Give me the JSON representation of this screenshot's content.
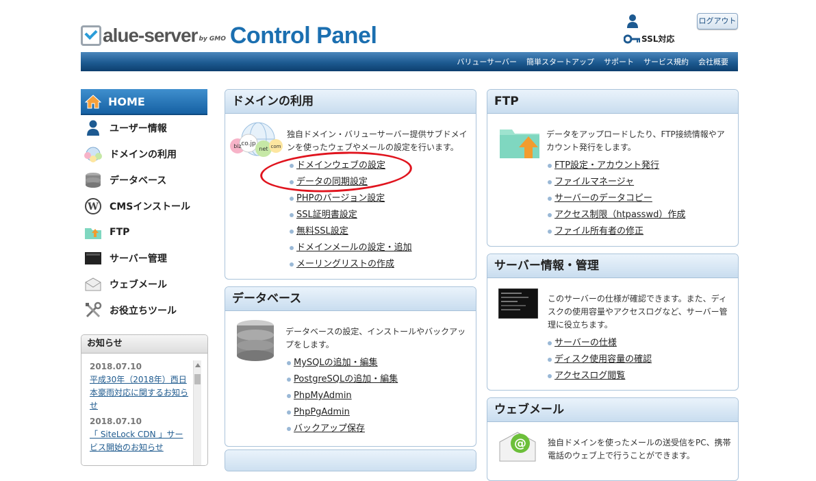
{
  "header": {
    "logo_text": "alue-server",
    "logo_by": "by GMO",
    "title": "Control Panel",
    "ssl_label": "SSL対応",
    "logout_label": "ログアウト",
    "user_icon": "user-icon",
    "key_icon": "key-icon"
  },
  "topnav": [
    "バリューサーバー",
    "簡単スタートアップ",
    "サポート",
    "サービス規約",
    "会社概要"
  ],
  "sidebar": {
    "home_label": "HOME",
    "items": [
      {
        "label": "ユーザー情報",
        "icon": "user-icon"
      },
      {
        "label": "ドメインの利用",
        "icon": "globe-icon"
      },
      {
        "label": "データベース",
        "icon": "database-icon"
      },
      {
        "label": "CMSインストール",
        "icon": "wordpress-icon"
      },
      {
        "label": "FTP",
        "icon": "ftp-folder-icon"
      },
      {
        "label": "サーバー管理",
        "icon": "terminal-icon"
      },
      {
        "label": "ウェブメール",
        "icon": "mail-icon"
      },
      {
        "label": "お役立ちツール",
        "icon": "tools-icon"
      }
    ]
  },
  "news": {
    "title": "お知らせ",
    "items": [
      {
        "date": "2018.07.10",
        "text": "平成30年（2018年）西日本豪雨対応に関するお知らせ"
      },
      {
        "date": "2018.07.10",
        "text": "「 SiteLock CDN 」サービス開始のお知らせ"
      }
    ]
  },
  "domain_panel": {
    "title": "ドメインの利用",
    "desc": "独自ドメイン・バリューサーバー提供サブドメインを使ったウェブやメールの設定を行います。",
    "globe_tags": [
      "biz",
      "co.jp",
      "net",
      "com"
    ],
    "links": [
      "ドメインウェブの設定",
      "データの同期設定",
      "PHPのバージョン設定",
      "SSL証明書設定",
      "無料SSL設定",
      "ドメインメールの設定・追加",
      "メーリングリストの作成"
    ]
  },
  "db_panel": {
    "title": "データベース",
    "desc": "データベースの設定、インストールやバックアップをします。",
    "links": [
      "MySQLの追加・編集",
      "PostgreSQLの追加・編集",
      "PhpMyAdmin",
      "PhpPgAdmin",
      "バックアップ保存"
    ]
  },
  "ftp_panel": {
    "title": "FTP",
    "desc": "データをアップロードしたり、FTP接続情報やアカウント発行をします。",
    "links": [
      "FTP設定・アカウント発行",
      "ファイルマネージャ",
      "サーバーのデータコピー",
      "アクセス制限（htpasswd）作成",
      "ファイル所有者の修正"
    ]
  },
  "server_panel": {
    "title": "サーバー情報・管理",
    "desc": "このサーバーの仕様が確認できます。また、ディスクの使用容量やアクセスログなど、サーバー管理に役立ちます。",
    "links": [
      "サーバーの仕様",
      "ディスク使用容量の確認",
      "アクセスログ閲覧"
    ]
  },
  "webmail_panel": {
    "title": "ウェブメール",
    "desc": "独自ドメインを使ったメールの送受信をPC、携帯電話のウェブ上で行うことができます。"
  },
  "colors": {
    "brand_blue": "#1b6fb0",
    "nav_dark": "#0d3f6e",
    "annotation_red": "#e0141e"
  }
}
